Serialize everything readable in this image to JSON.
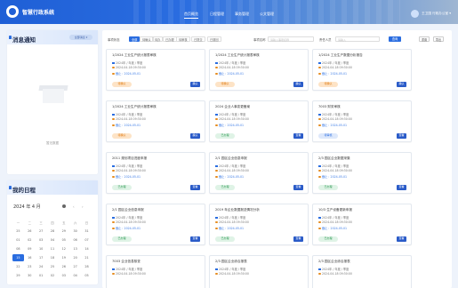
{
  "app": {
    "title": "智慧行政系统"
  },
  "nav": [
    {
      "label": "首页概览",
      "active": true
    },
    {
      "label": "日程管理",
      "active": false
    },
    {
      "label": "事务管理",
      "active": false
    },
    {
      "label": "公文管理",
      "active": false
    }
  ],
  "user": {
    "name": "王卫国 行政办公室 ▾"
  },
  "messages": {
    "title": "消息通知",
    "tab": "全部消息 ▾",
    "empty": "暂无数据"
  },
  "calendar": {
    "title": "我的日程",
    "month": "2024 年 4 月",
    "prev": "‹",
    "next": "›",
    "weekdays": [
      "一",
      "二",
      "三",
      "四",
      "五",
      "六",
      "日"
    ],
    "weeks": [
      [
        "25",
        "26",
        "27",
        "28",
        "29",
        "30",
        "31"
      ],
      [
        "01",
        "02",
        "03",
        "04",
        "05",
        "06",
        "07"
      ],
      [
        "08",
        "09",
        "10",
        "11",
        "12",
        "13",
        "14"
      ],
      [
        "15",
        "16",
        "17",
        "18",
        "19",
        "20",
        "21"
      ],
      [
        "22",
        "23",
        "24",
        "25",
        "26",
        "27",
        "28"
      ],
      [
        "29",
        "30",
        "01",
        "02",
        "03",
        "04",
        "05"
      ]
    ],
    "today_week": 3,
    "today_col": 0
  },
  "filter": {
    "status_label": "事项状态",
    "chips": [
      "全部",
      "待确认",
      "待办",
      "已办理",
      "待审核",
      "已提交",
      "已退回"
    ],
    "active_chip": 0,
    "name_label": "事项名称",
    "name_placeholder": "请输入事项名称",
    "person_label": "责任人员",
    "person_placeholder": "请输入",
    "search": "查询",
    "reset": "重置",
    "export": "导出"
  },
  "cards": [
    {
      "title": "1/2024 工业生产统计报表审核",
      "date": "2024年 / 年度 / 季度",
      "time": "2024-04-18 09:30:00",
      "deadline": "截止：2024-05-01",
      "status": "待确认",
      "tone": "orange",
      "action": "确认"
    },
    {
      "title": "1/2024 工业生产统计报表审核",
      "date": "2024年 / 年度 / 季度",
      "time": "2024-04-18 09:30:00",
      "deadline": "截止：2024-05-01",
      "status": "待确认",
      "tone": "orange",
      "action": "确认"
    },
    {
      "title": "1/2024 工业生产数据分析报告",
      "date": "2024年 / 年度 / 季度",
      "time": "2024-04-18 09:30:00",
      "deadline": "截止：2024-05-01",
      "status": "待确认",
      "tone": "orange",
      "action": "确认"
    },
    {
      "title": "1/2024 工业生产统计报表审核",
      "date": "2024年 / 年度 / 季度",
      "time": "2024-04-18 09:30:00",
      "deadline": "截止：2024-05-01",
      "status": "待确认",
      "tone": "orange",
      "action": "确认"
    },
    {
      "title": "2024 企业人事变更备案",
      "date": "2024年 / 年度 / 季度",
      "time": "2024-04-18 09:30:00",
      "deadline": "截止：2024-05-01",
      "status": "已办理",
      "tone": "green",
      "action": "查看"
    },
    {
      "title": "7003 财务审核",
      "date": "2024年 / 年度 / 季度",
      "time": "2024-04-18 09:30:00",
      "deadline": "截止：2024-05-01",
      "status": "待审核",
      "tone": "blue",
      "action": "查看"
    },
    {
      "title": "2011 规划项目进度申报",
      "date": "2024年 / 年度 / 季度",
      "time": "2024-04-18 09:30:00",
      "deadline": "截止：2024-05-01",
      "status": "已办理",
      "tone": "green",
      "action": "查看"
    },
    {
      "title": "2/1 园区企业信息申报",
      "date": "2024年 / 年度 / 季度",
      "time": "2024-04-18 09:30:00",
      "deadline": "截止：2024-05-01",
      "status": "已办理",
      "tone": "green",
      "action": "查看"
    },
    {
      "title": "2/3 园区企业数据采集",
      "date": "2024年 / 年度 / 季度",
      "time": "2024-04-18 09:30:00",
      "deadline": "截止：2024-05-01",
      "status": "已办理",
      "tone": "green",
      "action": "查看"
    },
    {
      "title": "2/1 园区企业信息申报",
      "date": "2024年 / 年度 / 季度",
      "time": "2024-04-18 09:30:00",
      "deadline": "截止：2024-05-01",
      "status": "已办理",
      "tone": "green",
      "action": "查看"
    },
    {
      "title": "2019 年企业数据报送情况分析",
      "date": "2024年 / 年度 / 季度",
      "time": "2024-04-18 09:30:00",
      "deadline": "截止：2024-05-01",
      "status": "已办理",
      "tone": "green",
      "action": "查看"
    },
    {
      "title": "10/3 生产设备更新申报",
      "date": "2024年 / 年度 / 季度",
      "time": "2024-04-18 09:30:00",
      "deadline": "截止：2024-05-01",
      "status": "已办理",
      "tone": "green",
      "action": "查看"
    },
    {
      "title": "7003 企业信息核查",
      "date": "2024年 / 年度 / 季度",
      "time": "2024-04-18 09:30:00",
      "deadline": "",
      "status": "",
      "tone": "green",
      "action": ""
    },
    {
      "title": "2/3 园区企业综合报表",
      "date": "2024年 / 年度 / 季度",
      "time": "2024-04-18 09:30:00",
      "deadline": "",
      "status": "",
      "tone": "green",
      "action": ""
    },
    {
      "title": "2/3 园区企业综合报表",
      "date": "2024年 / 年度 / 季度",
      "time": "2024-04-18 09:30:00",
      "deadline": "",
      "status": "",
      "tone": "green",
      "action": ""
    }
  ]
}
